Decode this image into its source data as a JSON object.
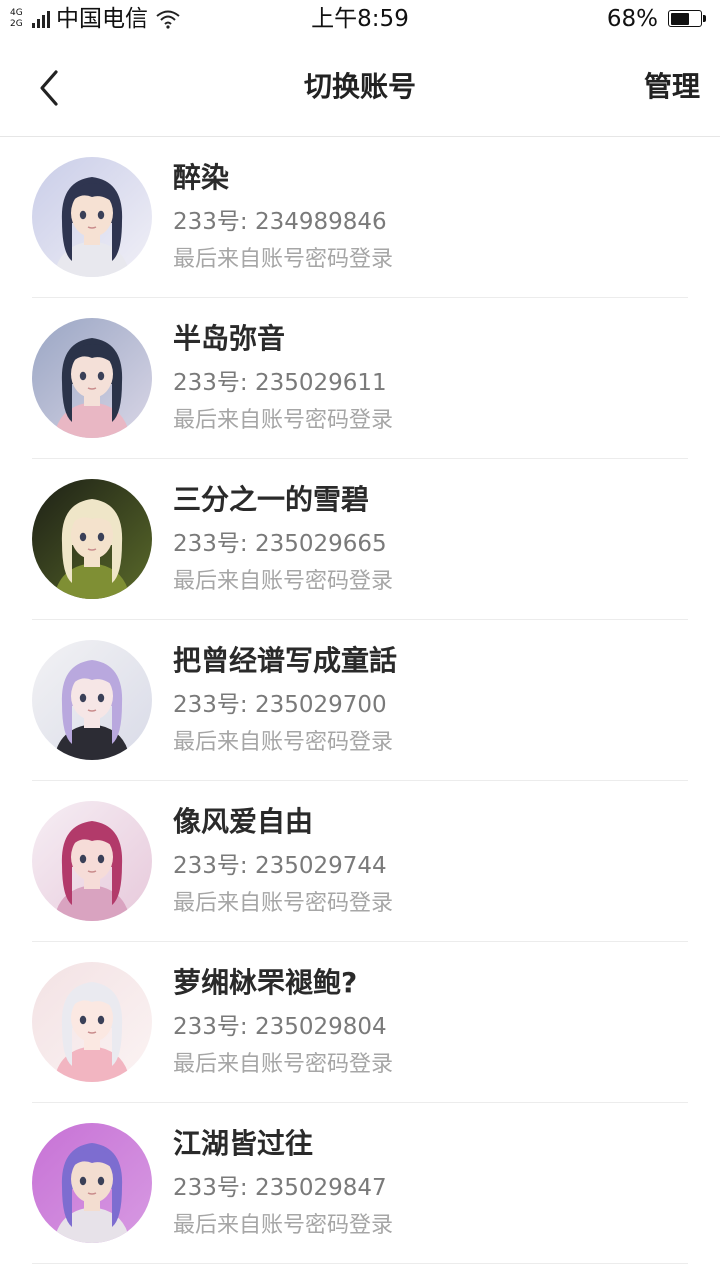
{
  "status_bar": {
    "network_top": "4G",
    "network_bottom": "2G",
    "carrier": "中国电信",
    "time": "上午8:59",
    "battery_percent": "68%",
    "battery_level": 0.68
  },
  "nav": {
    "title": "切换账号",
    "manage_label": "管理"
  },
  "accounts": [
    {
      "name": "醉染",
      "uid": "233号: 234989846",
      "login": "最后来自账号密码登录",
      "avatar": {
        "bg1": "#c9cde8",
        "bg2": "#f1f0f7",
        "hair": "#2f3550",
        "skin": "#f6e1d3",
        "cloth": "#e8e8ee"
      }
    },
    {
      "name": "半岛弥音",
      "uid": "233号: 235029611",
      "login": "最后来自账号密码登录",
      "avatar": {
        "bg1": "#9aa6c4",
        "bg2": "#d9d6e6",
        "hair": "#2b3349",
        "skin": "#f4e0d8",
        "cloth": "#e9b7c4"
      }
    },
    {
      "name": "三分之一的雪碧",
      "uid": "233号: 235029665",
      "login": "最后来自账号密码登录",
      "avatar": {
        "bg1": "#1d2016",
        "bg2": "#5a6a2a",
        "hair": "#efe6c8",
        "skin": "#f4e2cc",
        "cloth": "#7f8f34"
      }
    },
    {
      "name": "把曾经谱写成童話",
      "uid": "233号: 235029700",
      "login": "最后来自账号密码登录",
      "avatar": {
        "bg1": "#f2f2f4",
        "bg2": "#d9dbe8",
        "hair": "#b9a8de",
        "skin": "#f6e6e6",
        "cloth": "#2c2c34"
      }
    },
    {
      "name": "像风爱自由",
      "uid": "233号: 235029744",
      "login": "最后来自账号密码登录",
      "avatar": {
        "bg1": "#f6eef4",
        "bg2": "#e7c9db",
        "hair": "#b23a6a",
        "skin": "#f6dcd8",
        "cloth": "#d9a3c0"
      }
    },
    {
      "name": "萝缃栤罘褪鲍?",
      "uid": "233号: 235029804",
      "login": "最后来自账号密码登录",
      "avatar": {
        "bg1": "#f3e2e4",
        "bg2": "#fbf3f3",
        "hair": "#eaeaf0",
        "skin": "#fbe8e2",
        "cloth": "#f2b5c1"
      }
    },
    {
      "name": "江湖皆过往",
      "uid": "233号: 235029847",
      "login": "最后来自账号密码登录",
      "avatar": {
        "bg1": "#c772d6",
        "bg2": "#d79ae2",
        "hair": "#7d6dd0",
        "skin": "#f3ddd0",
        "cloth": "#e7e2e9"
      }
    }
  ]
}
